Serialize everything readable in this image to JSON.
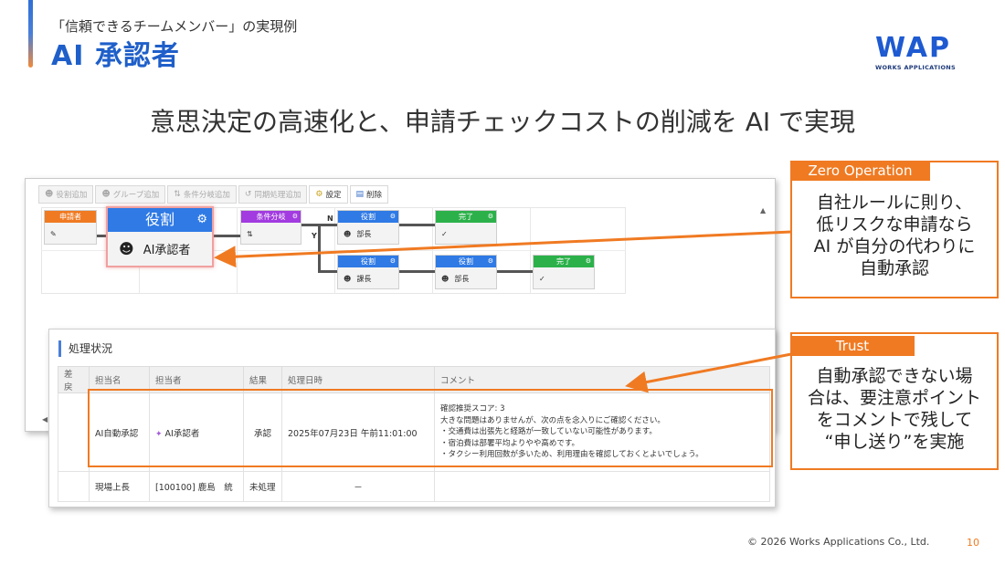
{
  "header": {
    "subtitle": "「信頼できるチームメンバー」の実現例",
    "title": "AI 承認者"
  },
  "logo": {
    "mark": "WAP",
    "sub": "WORKS APPLICATIONS"
  },
  "headline": "意思決定の高速化と、申請チェックコストの削減を AI で実現",
  "workflow": {
    "toolbar": [
      {
        "label": "役割追加",
        "icon": "person-icon"
      },
      {
        "label": "グループ追加",
        "icon": "group-icon"
      },
      {
        "label": "条件分岐追加",
        "icon": "branch-icon"
      },
      {
        "label": "同期処理追加",
        "icon": "sync-icon"
      },
      {
        "label": "設定",
        "icon": "settings-icon"
      },
      {
        "label": "削除",
        "icon": "delete-icon"
      }
    ],
    "nodes": {
      "applicant": {
        "head": "申請者"
      },
      "ai_role": {
        "head": "役割",
        "body": "AI承認者"
      },
      "condition": {
        "head": "条件分岐"
      },
      "role1": {
        "head": "役割",
        "body": "部長"
      },
      "done1": {
        "head": "完了",
        "body": "✓"
      },
      "role2": {
        "head": "役割",
        "body": "課長"
      },
      "role3": {
        "head": "役割",
        "body": "部長"
      },
      "done2": {
        "head": "完了",
        "body": "✓"
      }
    },
    "branch_labels": {
      "no": "N",
      "yes": "Y"
    }
  },
  "status": {
    "title": "処理状況",
    "columns": [
      "差 戻",
      "担当名",
      "担当者",
      "結果",
      "処理日時",
      "コメント"
    ],
    "rows": [
      {
        "role": "AI自動承認",
        "person": "AI承認者",
        "result": "承認",
        "datetime": "2025年07月23日 午前11:01:00",
        "comment": [
          "確認推奨スコア: 3",
          "大きな問題はありませんが、次の点を念入りにご確認ください。",
          "・交通費は出張先と経路が一致していない可能性があります。",
          "・宿泊費は部署平均よりやや高めです。",
          "・タクシー利用回数が多いため、利用理由を確認しておくとよいでしょう。"
        ]
      },
      {
        "role": "現場上長",
        "person": "[100100] 鹿島　統",
        "result": "未処理",
        "datetime": "－",
        "comment": []
      }
    ]
  },
  "callouts": {
    "zero": {
      "tag": "Zero Operation",
      "lines": [
        "自社ルールに則り、",
        "低リスクな申請なら",
        "AI が自分の代わりに",
        "自動承認"
      ]
    },
    "trust": {
      "tag": "Trust",
      "lines": [
        "自動承認できない場",
        "合は、要注意ポイント",
        "をコメントで残して",
        "“申し送り”を実施"
      ]
    }
  },
  "footer": {
    "copyright": "© 2026 Works Applications Co., Ltd.",
    "page": "10"
  },
  "colors": {
    "accent_blue": "#1f5fc9",
    "accent_orange": "#f07a22"
  }
}
